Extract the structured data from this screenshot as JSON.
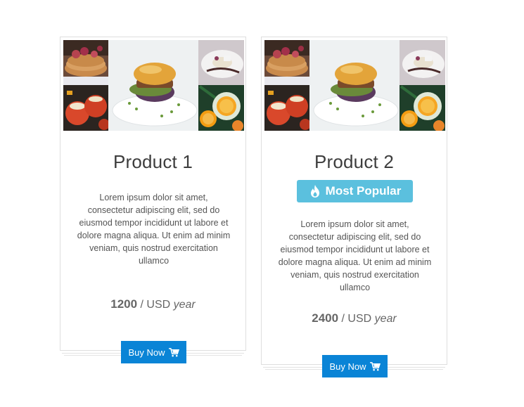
{
  "products": [
    {
      "title": "Product 1",
      "badge": null,
      "description": "Lorem ipsum dolor sit amet, consectetur adipiscing elit, sed do eiusmod tempor incididunt ut labore et dolore magna aliqua. Ut enim ad minim veniam, quis nostrud exercitation ullamco",
      "price": "1200",
      "price_sep": " / USD ",
      "price_unit": "year",
      "button_label": "Buy Now",
      "images": [
        "pancakes-berries",
        "stuffed-tomatoes",
        "burger-plate",
        "dessert-plate",
        "orange-drinks"
      ]
    },
    {
      "title": "Product 2",
      "badge": "Most Popular",
      "description": "Lorem ipsum dolor sit amet, consectetur adipiscing elit, sed do eiusmod tempor incididunt ut labore et dolore magna aliqua. Ut enim ad minim veniam, quis nostrud exercitation ullamco",
      "price": "2400",
      "price_sep": " / USD ",
      "price_unit": "year",
      "button_label": "Buy Now",
      "images": [
        "pancakes-berries",
        "stuffed-tomatoes",
        "burger-plate",
        "dessert-plate",
        "orange-drinks"
      ]
    }
  ],
  "icons": {
    "badge": "flame-icon",
    "button": "shopping-cart-icon"
  },
  "colors": {
    "badge_bg": "#5bc0de",
    "button_bg": "#0a84d6",
    "title": "#3d3d3d",
    "text": "#555555"
  }
}
